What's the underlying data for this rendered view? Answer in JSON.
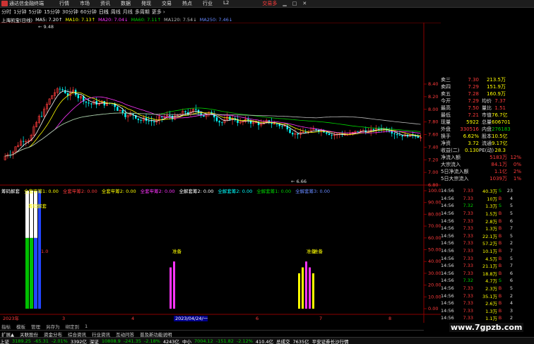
{
  "titlebar": {
    "app_title": "通达信金融终端",
    "menu": [
      "行情",
      "市场",
      "资讯",
      "数据",
      "発现",
      "交易",
      "热点",
      "行业",
      "L2"
    ],
    "trade": "交易多"
  },
  "periodbar": [
    "分时",
    "1分钟",
    "5分钟",
    "15分钟",
    "30分钟",
    "60分钟",
    "日线",
    "周线",
    "月线",
    "多周期",
    "更多 ›"
  ],
  "ma_line": {
    "stock": "上海凯宝(日线)",
    "ma5": "MA5: 7.20↑",
    "ma10": "MA10: 7.13↑",
    "ma20": "MA20: 7.04↓",
    "ma60": "MA60: 7.11↑",
    "ma120": "MA120: 7.54↓",
    "ma250": "MA250: 7.46↓"
  },
  "price_axis": [
    "8.40",
    "8.20",
    "8.00",
    "7.80",
    "7.60",
    "7.40",
    "7.20",
    "7.00",
    "6.80"
  ],
  "price_labels": {
    "high": "9.48",
    "low": "6.66"
  },
  "ind_axis": [
    "100.00",
    "90.00",
    "80.00",
    "70.00",
    "60.00",
    "50.00",
    "40.00",
    "30.00",
    "20.00",
    "10.00",
    "0.00"
  ],
  "ind_line": {
    "name": "筹码解套",
    "v1": "全套牢筹1: 0.00",
    "v2": "全套牢筹2: 0.00",
    "v3": "全套牢筹2: 0.00",
    "v4": "全套牢筹2: 0.00",
    "v5": "全解套筹2: 0.00",
    "v6": "全解套筹2: 0.00",
    "v7": "全解套筹1: 0.00",
    "v8": "全解套筹3: 0.00"
  },
  "ind_texts": [
    "筹码解套",
    "1.0",
    "准备",
    "准备",
    "准备"
  ],
  "date_axis": [
    "2023年",
    "3",
    "4",
    "2023/04/24/一",
    "6",
    "7",
    "8"
  ],
  "quotes": {
    "asks": [
      {
        "label": "卖三",
        "price": "7.30",
        "vol": "213.5万"
      },
      {
        "label": "卖四",
        "price": "7.29",
        "vol": "151.9万"
      },
      {
        "label": "卖五",
        "price": "7.28",
        "vol": "160.9万"
      }
    ],
    "stats": [
      {
        "l1": "今开",
        "v1": "7.29",
        "l2": "均价",
        "v2": "7.37"
      },
      {
        "l1": "最高",
        "v1": "7.50",
        "l2": "量比",
        "v2": "1.51"
      },
      {
        "l1": "最低",
        "v1": "7.21",
        "l2": "市值",
        "v2": "76.7亿"
      },
      {
        "l1": "现量",
        "v1": "5922",
        "l2": "总量",
        "v2": "606701"
      },
      {
        "l1": "外盘",
        "v1": "330516",
        "l2": "内盘",
        "v2": "276183"
      },
      {
        "l1": "换手",
        "v1": "6.62%",
        "l2": "股本",
        "v2": "10.5亿"
      },
      {
        "l1": "净资",
        "v1": "3.72",
        "l2": "流通",
        "v2": "9.17亿"
      },
      {
        "l1": "收益(二)",
        "v1": "0.130",
        "l2": "PE(动)",
        "v2": "28.3"
      }
    ],
    "flows": [
      {
        "l": "净流入额",
        "v": "5183万",
        "p": "12%"
      },
      {
        "l": "大宗流入",
        "v": "84.1万",
        "p": "0%"
      },
      {
        "l": "5日净流入额",
        "v": "1.1亿",
        "p": "2%"
      },
      {
        "l": "5日大宗流入",
        "v": "1039万",
        "p": "1%"
      }
    ]
  },
  "ticks": [
    {
      "t": "14:56",
      "p": "7.33",
      "vol": "40.3万",
      "bs": "S",
      "n": "23"
    },
    {
      "t": "14:56",
      "p": "7.33",
      "vol": "10万",
      "bs": "B",
      "n": "4"
    },
    {
      "t": "14:56",
      "p": "7.32",
      "vol": "1.3万",
      "bs": "S",
      "n": "5"
    },
    {
      "t": "14:56",
      "p": "7.33",
      "vol": "1.5万",
      "bs": "B",
      "n": "5"
    },
    {
      "t": "14:56",
      "p": "7.33",
      "vol": "2.8万",
      "bs": "B",
      "n": "6"
    },
    {
      "t": "14:56",
      "p": "7.33",
      "vol": "1.3万",
      "bs": "B",
      "n": "7"
    },
    {
      "t": "14:56",
      "p": "7.33",
      "vol": "22.1万",
      "bs": "B",
      "n": "5"
    },
    {
      "t": "14:56",
      "p": "7.33",
      "vol": "57.2万",
      "bs": "B",
      "n": "2"
    },
    {
      "t": "14:56",
      "p": "7.33",
      "vol": "10.1万",
      "bs": "B",
      "n": "7"
    },
    {
      "t": "14:56",
      "p": "7.33",
      "vol": "4.5万",
      "bs": "B",
      "n": "5"
    },
    {
      "t": "14:56",
      "p": "7.33",
      "vol": "21.1万",
      "bs": "B",
      "n": "7"
    },
    {
      "t": "14:56",
      "p": "7.33",
      "vol": "18.8万",
      "bs": "B",
      "n": "6"
    },
    {
      "t": "14:56",
      "p": "7.32",
      "vol": "4.7万",
      "bs": "S",
      "n": "6"
    },
    {
      "t": "14:56",
      "p": "7.33",
      "vol": "2.3万",
      "bs": "B",
      "n": "5"
    },
    {
      "t": "14:56",
      "p": "7.33",
      "vol": "35.1万",
      "bs": "B",
      "n": "2"
    },
    {
      "t": "14:56",
      "p": "7.33",
      "vol": "2.6万",
      "bs": "B",
      "n": "4"
    },
    {
      "t": "14:56",
      "p": "7.33",
      "vol": "1.3万",
      "bs": "B",
      "n": "3"
    },
    {
      "t": "14:56",
      "p": "7.33",
      "vol": "1.1万",
      "bs": "B",
      "n": "2"
    }
  ],
  "tabs2": [
    "指标",
    "模板",
    "管理",
    "另存为",
    "绑定到",
    "1"
  ],
  "tabs": [
    "扩展▲",
    "关联股份",
    "资金分布",
    "综合资讯",
    "行业资讯",
    "互动问答",
    "普及新功能说明"
  ],
  "statusbar": {
    "sh_name": "上证",
    "sh_val": "3189.25",
    "sh_chg": "-65.31",
    "sh_pct": "-2.01%",
    "sh_amt": "3392亿",
    "sz_name": "深证",
    "sz_val": "10808.9",
    "sz_chg": "-241.35",
    "sz_pct": "-2.18%",
    "sz_amt": "4243亿",
    "zx_name": "中小",
    "zx_val": "7004.12",
    "zx_chg": "-151.82",
    "zx_pct": "-2.12%",
    "zx_amt": "410.4亿",
    "total": "总成交",
    "total_amt": "7635亿",
    "info": "平安证券长沙行情"
  },
  "watermark": "www.7gpzb.com",
  "colors": {
    "up": "#ff3b3b",
    "down": "#00ffff",
    "ma5": "#ffffff",
    "ma10": "#ffff00",
    "ma20": "#ff33ff",
    "ma60": "#00d000",
    "ma120": "#bbbbbb"
  }
}
